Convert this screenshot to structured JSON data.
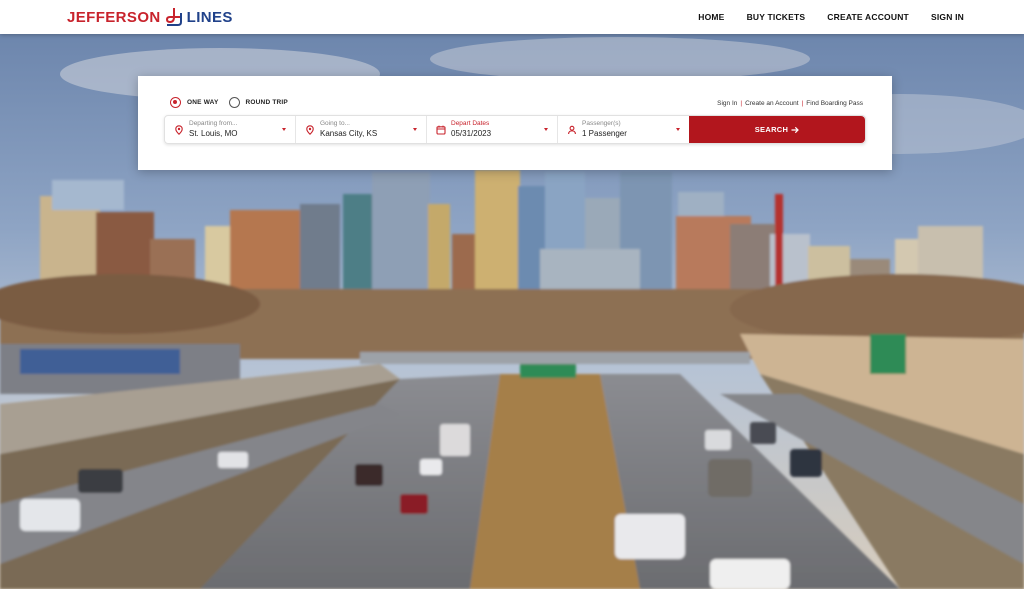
{
  "brand": {
    "word1": "JEFFERSON",
    "word2": "LINES",
    "red": "#c8232c",
    "blue": "#21428a"
  },
  "nav": {
    "items": [
      "HOME",
      "BUY TICKETS",
      "CREATE ACCOUNT",
      "SIGN IN"
    ]
  },
  "search": {
    "trip_types": [
      {
        "label": "ONE WAY",
        "selected": true
      },
      {
        "label": "ROUND TRIP",
        "selected": false
      }
    ],
    "links": [
      "Sign In",
      "Create an Account",
      "Find Boarding Pass"
    ],
    "from": {
      "label": "Departing from...",
      "value": "St. Louis, MO",
      "icon": "location-pin-icon"
    },
    "to": {
      "label": "Going to...",
      "value": "Kansas City, KS",
      "icon": "location-pin-icon"
    },
    "date": {
      "label": "Depart Dates",
      "value": "05/31/2023",
      "icon": "calendar-icon"
    },
    "passengers": {
      "label": "Passenger(s)",
      "value": "1 Passenger",
      "icon": "person-icon"
    },
    "button_label": "SEARCH",
    "button_color": "#b2161d"
  },
  "hero": {
    "description_icon": "city-highway-photo"
  }
}
